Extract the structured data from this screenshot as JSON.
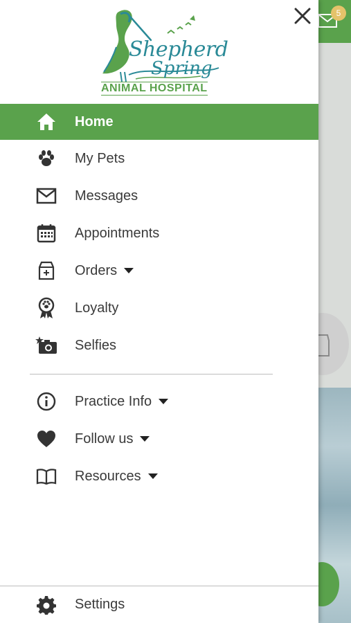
{
  "background": {
    "message_badge_count": "5"
  },
  "logo": {
    "line1": "Shepherd",
    "line2": "Spring",
    "line3": "ANIMAL HOSPITAL"
  },
  "menu": {
    "items": [
      {
        "label": "Home",
        "icon": "home-icon",
        "active": true
      },
      {
        "label": "My Pets",
        "icon": "paw-icon"
      },
      {
        "label": "Messages",
        "icon": "envelope-icon"
      },
      {
        "label": "Appointments",
        "icon": "calendar-icon"
      },
      {
        "label": "Orders",
        "icon": "pet-food-bag-icon",
        "has_dropdown": true
      },
      {
        "label": "Loyalty",
        "icon": "award-ribbon-icon"
      },
      {
        "label": "Selfies",
        "icon": "camera-star-icon"
      }
    ],
    "secondary": [
      {
        "label": "Practice Info",
        "icon": "info-circle-icon",
        "has_dropdown": true
      },
      {
        "label": "Follow us",
        "icon": "heart-icon",
        "has_dropdown": true
      },
      {
        "label": "Resources",
        "icon": "open-book-icon",
        "has_dropdown": true
      }
    ],
    "settings": {
      "label": "Settings",
      "icon": "gear-icon"
    }
  },
  "colors": {
    "accent": "#5aa24c",
    "logo_teal": "#2a8a97",
    "text": "#3a3a3a"
  }
}
